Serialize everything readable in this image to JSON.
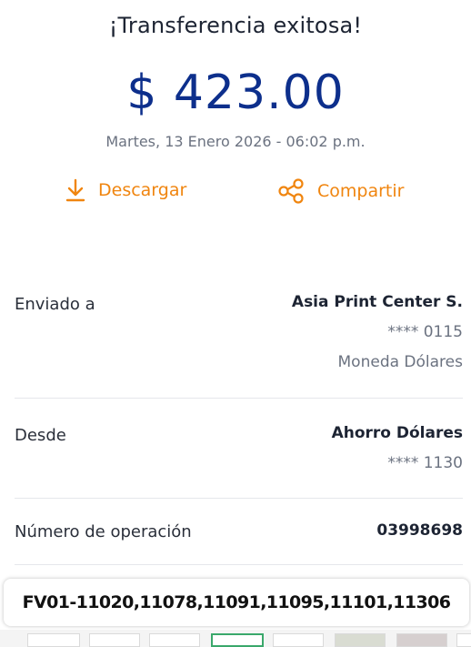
{
  "header": {
    "title": "¡Transferencia exitosa!"
  },
  "transfer": {
    "amount": "$ 423.00",
    "datetime": "Martes, 13 Enero 2026 - 06:02 p.m."
  },
  "actions": {
    "download_label": "Descargar",
    "share_label": "Compartir"
  },
  "details": {
    "sent_to": {
      "label": "Enviado a",
      "name": "Asia Print Center S.",
      "account": "**** 0115",
      "currency": "Moneda Dólares"
    },
    "from": {
      "label": "Desde",
      "account_name": "Ahorro Dólares",
      "account": "**** 1130"
    },
    "operation": {
      "label": "Número de operación",
      "number": "03998698"
    }
  },
  "note": {
    "text": "FV01-11020,11078,11091,11095,11101,11306"
  },
  "colors": {
    "title": "#1d2433",
    "amount": "#0d2f8c",
    "accent": "#f0850f",
    "muted": "#6b7280",
    "divider": "#e5e7eb"
  },
  "icons": {
    "download": "download-icon",
    "share": "share-icon"
  }
}
